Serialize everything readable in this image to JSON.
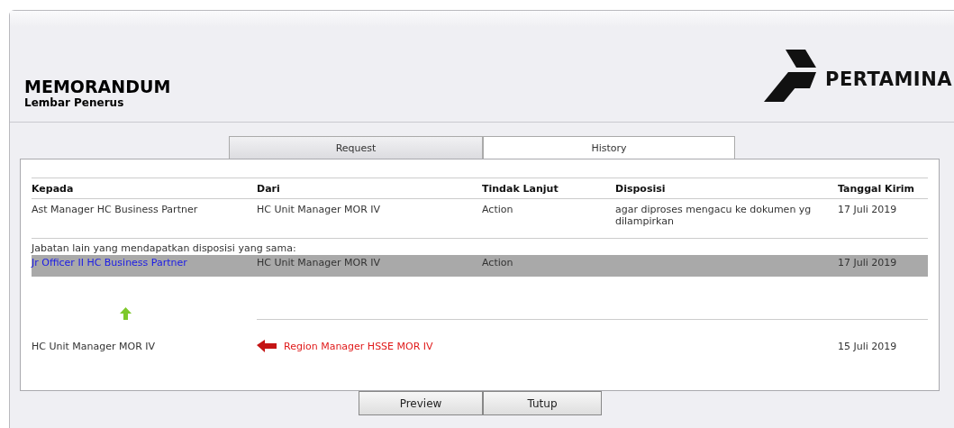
{
  "header": {
    "title": "MEMORANDUM",
    "subtitle": "Lembar Penerus",
    "logo_text": "PERTAMINA"
  },
  "tabs": [
    {
      "label": "Request",
      "selected": false
    },
    {
      "label": "History",
      "selected": true
    }
  ],
  "table": {
    "columns": [
      "Kepada",
      "Dari",
      "Tindak Lanjut",
      "Disposisi",
      "Tanggal Kirim"
    ],
    "rows": [
      {
        "cells": [
          "Ast Manager HC Business Partner",
          "HC Unit Manager MOR IV",
          "Action",
          "agar diproses mengacu ke dokumen yg dilampirkan",
          "17 Juli 2019"
        ]
      }
    ],
    "others_label": "Jabatan lain yang mendapatkan disposisi yang sama:",
    "other_rows": [
      {
        "selected": true,
        "cells": [
          "Jr Officer II HC Business Partner",
          "HC Unit Manager MOR IV",
          "Action",
          "",
          "17 Juli 2019"
        ]
      }
    ]
  },
  "trail": [
    {
      "recipient": "HC Unit Manager MOR IV",
      "sender": "Region Manager HSSE MOR IV",
      "date": "15 Juli 2019"
    }
  ],
  "buttons": [
    "Preview",
    "Tutup"
  ]
}
